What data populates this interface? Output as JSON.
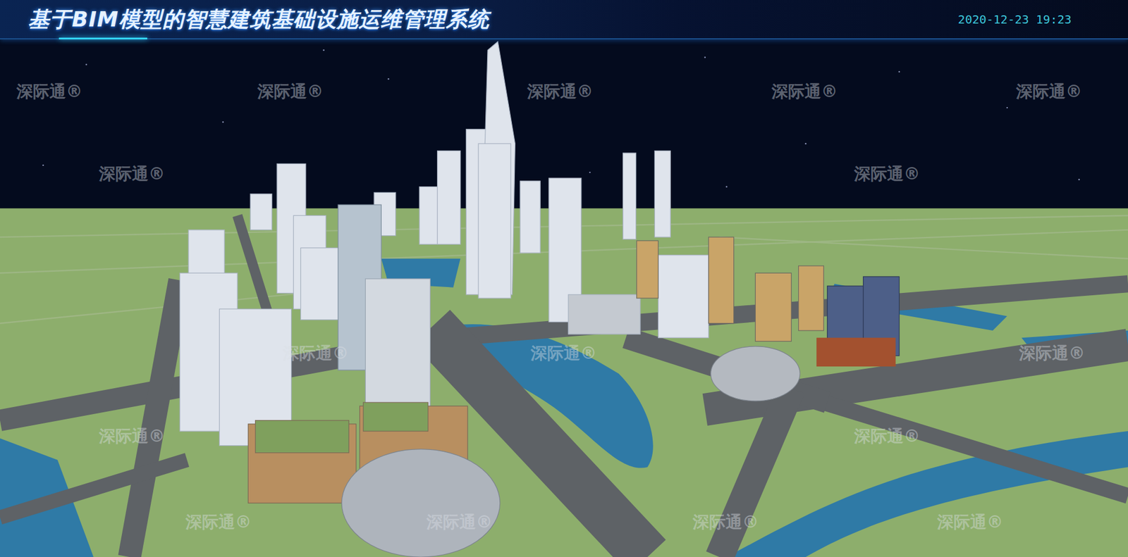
{
  "header": {
    "title": "基于BIM模型的智慧建筑基础设施运维管理系统",
    "datetime": "2020-12-23 19:23"
  },
  "watermarks": [
    "深际通®",
    "深际通®",
    "深际通®",
    "深际通®",
    "深际通®",
    "深际通®",
    "深际通®",
    "深际通®",
    "深际通®",
    "深际通®",
    "深际通®",
    "深际通®",
    "深际通®",
    "深际通®",
    "深际通®",
    "深际通®"
  ]
}
